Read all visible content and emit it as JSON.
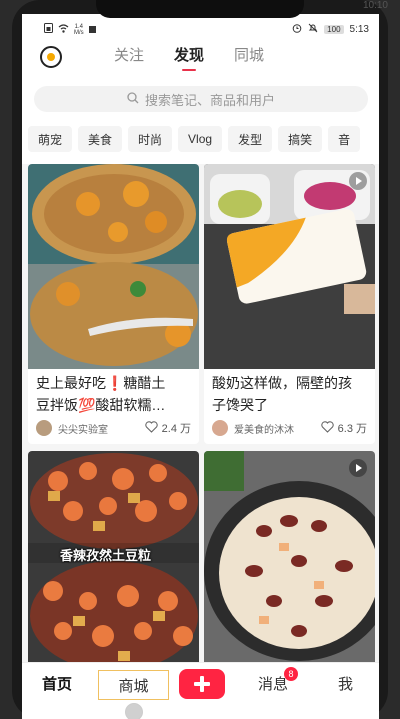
{
  "status": {
    "speed_top": "1.4",
    "speed_bottom": "M/s",
    "battery": "100",
    "time": "5:13"
  },
  "ghost_time": "10:10",
  "header": {
    "tabs": [
      {
        "label": "关注",
        "active": false
      },
      {
        "label": "发现",
        "active": true
      },
      {
        "label": "同城",
        "active": false
      }
    ]
  },
  "search": {
    "placeholder": "搜索笔记、商品和用户"
  },
  "categories": [
    "萌宠",
    "美食",
    "时尚",
    "Vlog",
    "发型",
    "搞笑",
    "音"
  ],
  "feed": [
    {
      "title_line1": "史上最好吃❗糖醋土",
      "title_line2": "豆拌饭💯酸甜软糯…",
      "author": "尖尖实验室",
      "likes": "2.4 万",
      "video": false,
      "img_overlay": ""
    },
    {
      "title_line1": "酸奶这样做，隔壁的孩",
      "title_line2": "子馋哭了",
      "author": "爱美食的沐沐",
      "likes": "6.3 万",
      "video": true,
      "img_overlay": ""
    },
    {
      "title_line1": "",
      "title_line2": "",
      "author": "",
      "likes": "",
      "video": false,
      "img_overlay": "香辣孜然土豆粒"
    },
    {
      "title_line1": "",
      "title_line2": "",
      "author": "",
      "likes": "",
      "video": true,
      "img_overlay": ""
    }
  ],
  "bottom_nav": {
    "home": "首页",
    "mall": "商城",
    "messages": "消息",
    "messages_badge": "8",
    "me": "我"
  },
  "colors": {
    "accent": "#ff2442",
    "tab_underline": "#e8324a",
    "logo": "#f5a800"
  }
}
